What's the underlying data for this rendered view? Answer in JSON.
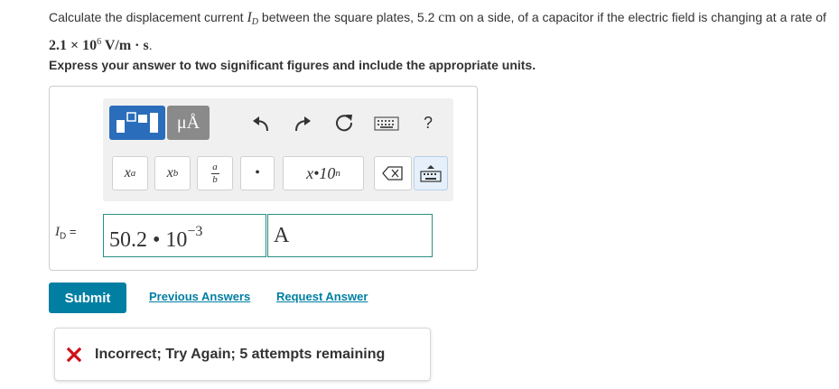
{
  "question": {
    "prefix": "Calculate the displacement current ",
    "var_symbol": "I",
    "var_sub": "D",
    "middle": " between the square plates, 5.2 ",
    "unit_cm": "cm",
    "suffix_1": " on a side, of a capacitor if the electric field is changing at a rate of ",
    "rate_mantissa": "2.1 × 10",
    "rate_exp": "6",
    "rate_unit": " V/m · s",
    "period": "."
  },
  "instruction": "Express your answer to two significant figures and include the appropriate units.",
  "toolbar": {
    "templates_icon": "templates-icon",
    "units_label": "μÅ",
    "undo_icon": "undo-icon",
    "redo_icon": "redo-icon",
    "reset_icon": "reset-icon",
    "keyboard_icon": "keyboard-icon",
    "help_label": "?",
    "keys": {
      "superscript": "x",
      "superscript_sup": "a",
      "subscript": "x",
      "subscript_sub": "b",
      "fraction_num": "a",
      "fraction_den": "b",
      "dot": "•",
      "sci": "x•10",
      "sci_sup": "n"
    }
  },
  "answer": {
    "var_symbol": "I",
    "var_sub": "D",
    "equals": " =",
    "value_mantissa": "50.2 • 10",
    "value_exp": "−3",
    "unit": "A"
  },
  "submit_label": "Submit",
  "links": {
    "previous": "Previous Answers",
    "request": "Request Answer"
  },
  "feedback": {
    "text": "Incorrect; Try Again; 5 attempts remaining"
  },
  "colors": {
    "submit": "#007fa3",
    "link": "#007fa3",
    "field_border": "#2a8f82",
    "error": "#d0101a",
    "templates": "#2a6ebb"
  }
}
